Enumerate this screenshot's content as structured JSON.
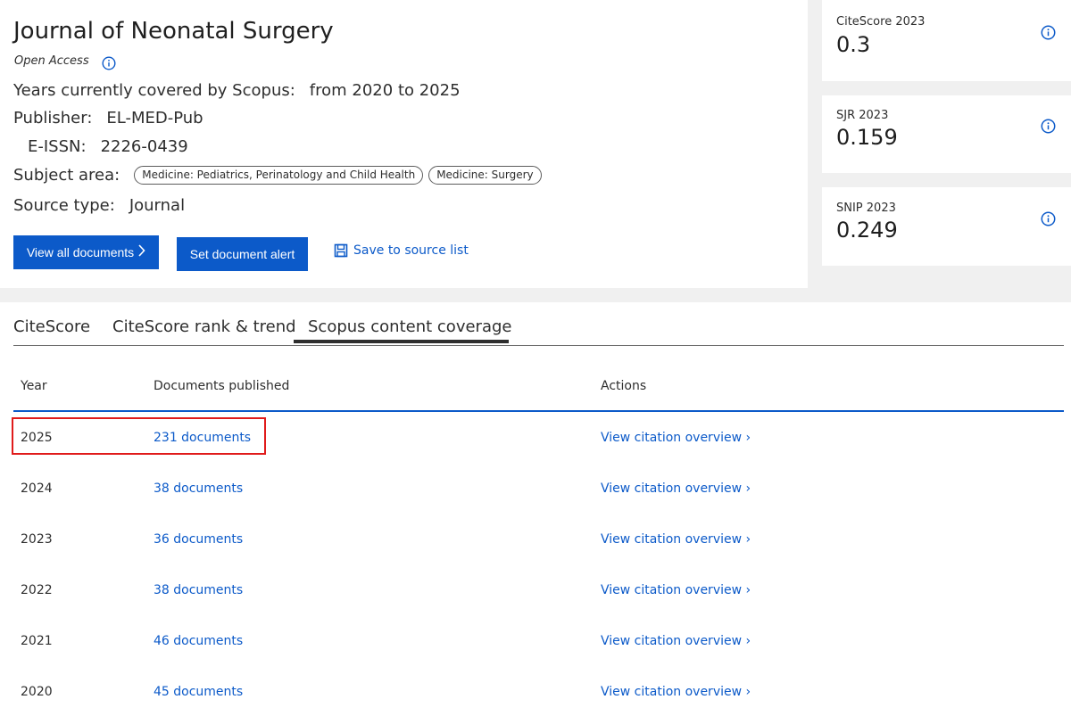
{
  "header": {
    "title": "Journal of Neonatal Surgery",
    "open_access": "Open Access",
    "years_label": "Years currently covered by Scopus:",
    "years_value": "from 2020 to 2025",
    "publisher_label": "Publisher:",
    "publisher_value": "EL-MED-Pub",
    "eissn_label": "E-ISSN:",
    "eissn_value": "2226-0439",
    "subject_label": "Subject area:",
    "subjects": [
      "Medicine: Pediatrics, Perinatology and Child Health",
      "Medicine: Surgery"
    ],
    "source_type_label": "Source type:",
    "source_type_value": "Journal"
  },
  "actions": {
    "view_all": "View all documents",
    "set_alert": "Set document alert",
    "save_list": "Save to source list"
  },
  "metrics": [
    {
      "label": "CiteScore 2023",
      "value": "0.3",
      "icon": "info-icon"
    },
    {
      "label": "SJR 2023",
      "value": "0.159",
      "icon": "info-icon"
    },
    {
      "label": "SNIP 2023",
      "value": "0.249",
      "icon": "info-icon"
    }
  ],
  "tabs": [
    "CiteScore",
    "CiteScore rank & trend",
    "Scopus content coverage"
  ],
  "active_tab": "Scopus content coverage",
  "table": {
    "headers": [
      "Year",
      "Documents published",
      "Actions"
    ],
    "rows": [
      {
        "year": "2025",
        "documents": "231 documents",
        "action": "View citation overview"
      },
      {
        "year": "2024",
        "documents": "38 documents",
        "action": "View citation overview"
      },
      {
        "year": "2023",
        "documents": "36 documents",
        "action": "View citation overview"
      },
      {
        "year": "2022",
        "documents": "38 documents",
        "action": "View citation overview"
      },
      {
        "year": "2021",
        "documents": "46 documents",
        "action": "View citation overview"
      },
      {
        "year": "2020",
        "documents": "45 documents",
        "action": "View citation overview"
      }
    ]
  },
  "colors": {
    "accent": "#0c5ac9",
    "highlight": "#e01b1b"
  }
}
